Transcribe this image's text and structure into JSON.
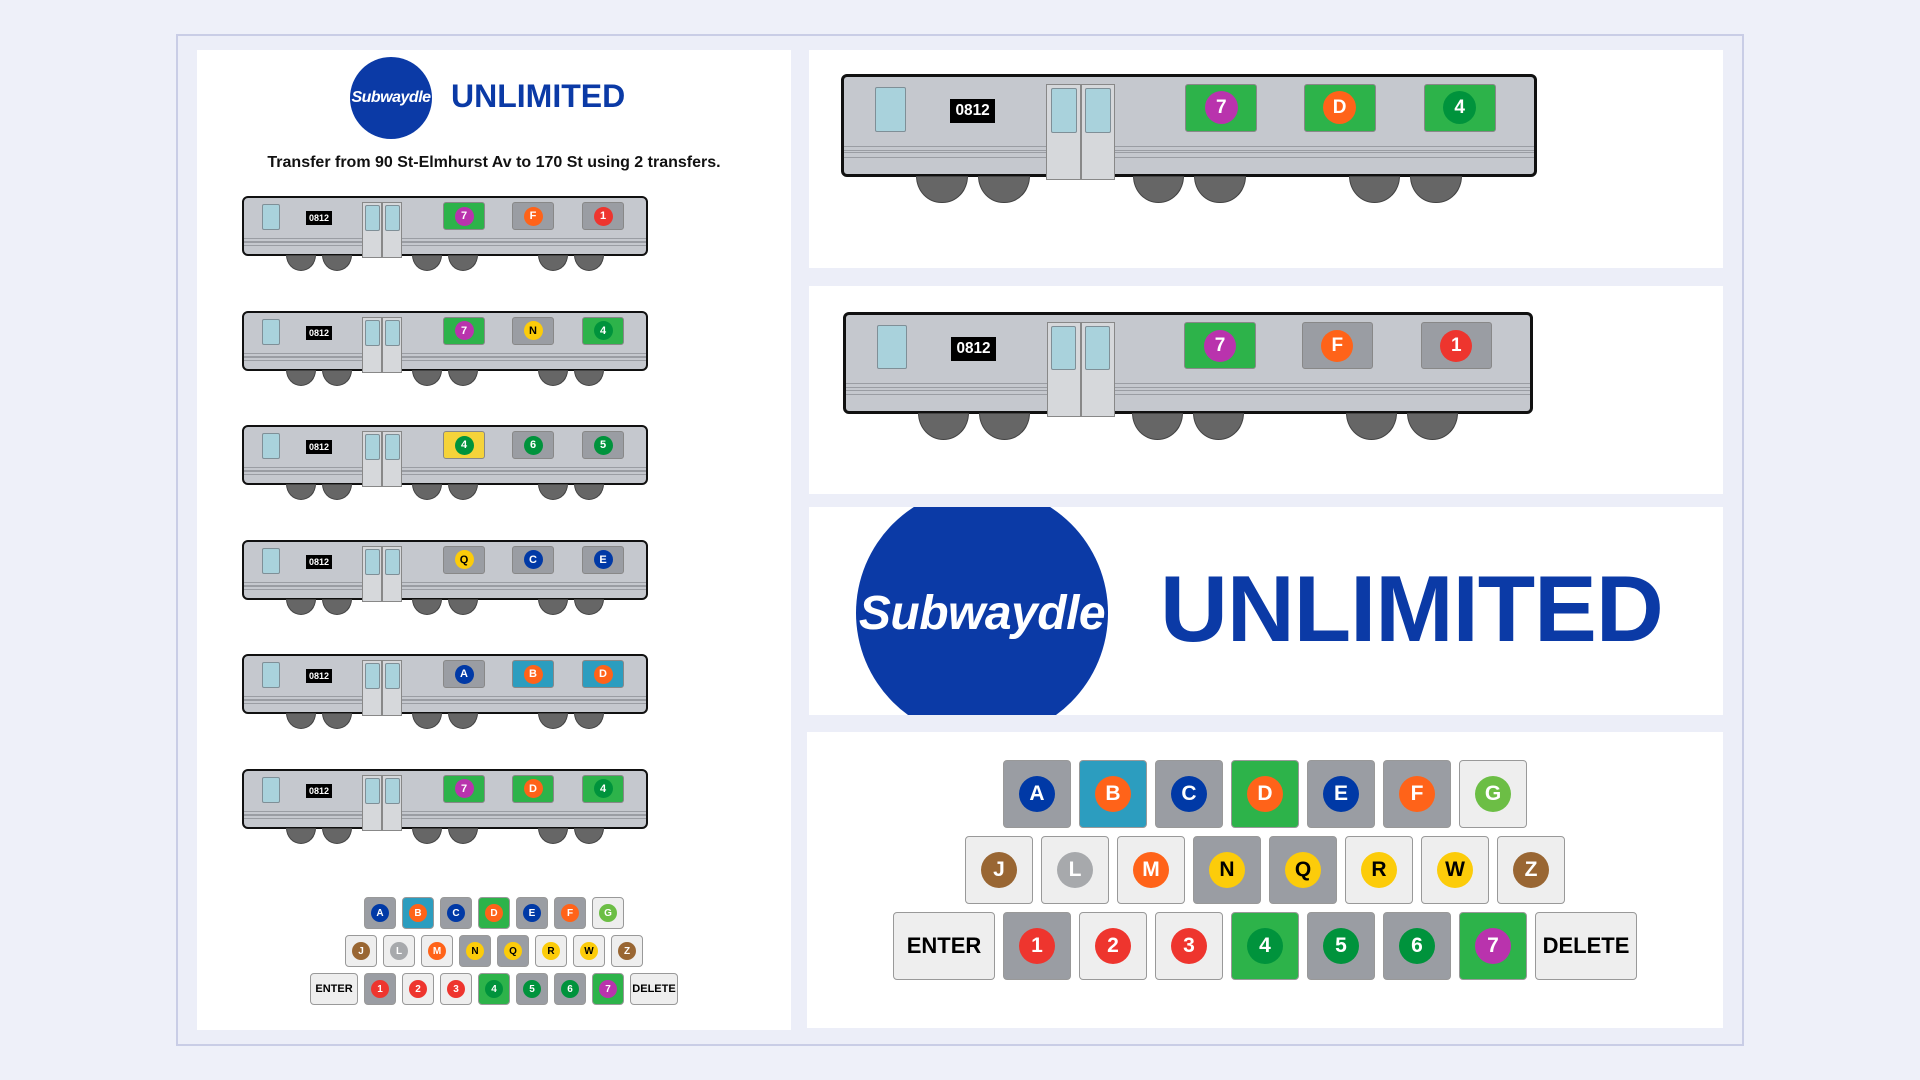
{
  "app": {
    "logo_text": "Subwaydle",
    "title": "UNLIMITED",
    "prompt": "Transfer from 90 St-Elmhurst Av to 170 St using 2 transfers.",
    "car_number": "0812"
  },
  "colors": {
    "brand_blue": "#0b3aa6",
    "green_correct": "#2db34a",
    "yellow_present": "#f5d33a",
    "teal_present": "#2c9dbf",
    "gray_absent": "#9a9da3",
    "car_body": "#c5c8ce"
  },
  "routes": {
    "A": {
      "color": "#0039a6",
      "text": "#fff"
    },
    "B": {
      "color": "#ff6319",
      "text": "#fff"
    },
    "C": {
      "color": "#0039a6",
      "text": "#fff"
    },
    "D": {
      "color": "#ff6319",
      "text": "#fff"
    },
    "E": {
      "color": "#0039a6",
      "text": "#fff"
    },
    "F": {
      "color": "#ff6319",
      "text": "#fff"
    },
    "G": {
      "color": "#6cbe45",
      "text": "#fff"
    },
    "J": {
      "color": "#996633",
      "text": "#fff"
    },
    "L": {
      "color": "#a7a9ac",
      "text": "#fff"
    },
    "M": {
      "color": "#ff6319",
      "text": "#fff"
    },
    "N": {
      "color": "#fccc0a",
      "text": "#000"
    },
    "Q": {
      "color": "#fccc0a",
      "text": "#000"
    },
    "R": {
      "color": "#fccc0a",
      "text": "#000"
    },
    "W": {
      "color": "#fccc0a",
      "text": "#000"
    },
    "Z": {
      "color": "#996633",
      "text": "#fff"
    },
    "1": {
      "color": "#ee352e",
      "text": "#fff"
    },
    "2": {
      "color": "#ee352e",
      "text": "#fff"
    },
    "3": {
      "color": "#ee352e",
      "text": "#fff"
    },
    "4": {
      "color": "#00933c",
      "text": "#fff"
    },
    "5": {
      "color": "#00933c",
      "text": "#fff"
    },
    "6": {
      "color": "#00933c",
      "text": "#fff"
    },
    "7": {
      "color": "#b933ad",
      "text": "#fff"
    }
  },
  "guesses": [
    [
      {
        "route": "7",
        "state": "correct"
      },
      {
        "route": "F",
        "state": "absent"
      },
      {
        "route": "1",
        "state": "absent"
      }
    ],
    [
      {
        "route": "7",
        "state": "correct"
      },
      {
        "route": "N",
        "state": "absent"
      },
      {
        "route": "4",
        "state": "correct"
      }
    ],
    [
      {
        "route": "4",
        "state": "present"
      },
      {
        "route": "6",
        "state": "absent"
      },
      {
        "route": "5",
        "state": "absent"
      }
    ],
    [
      {
        "route": "Q",
        "state": "absent"
      },
      {
        "route": "C",
        "state": "absent"
      },
      {
        "route": "E",
        "state": "absent"
      }
    ],
    [
      {
        "route": "A",
        "state": "absent"
      },
      {
        "route": "B",
        "state": "present-alt"
      },
      {
        "route": "D",
        "state": "present-alt"
      }
    ],
    [
      {
        "route": "7",
        "state": "correct"
      },
      {
        "route": "D",
        "state": "correct"
      },
      {
        "route": "4",
        "state": "correct"
      }
    ]
  ],
  "zoom_guesses": [
    [
      {
        "route": "7",
        "state": "correct"
      },
      {
        "route": "D",
        "state": "correct"
      },
      {
        "route": "4",
        "state": "correct"
      }
    ],
    [
      {
        "route": "7",
        "state": "correct"
      },
      {
        "route": "F",
        "state": "absent"
      },
      {
        "route": "1",
        "state": "absent"
      }
    ]
  ],
  "keyboard": {
    "rows": [
      [
        {
          "label": "A",
          "state": "absent"
        },
        {
          "label": "B",
          "state": "present-alt"
        },
        {
          "label": "C",
          "state": "absent"
        },
        {
          "label": "D",
          "state": "correct"
        },
        {
          "label": "E",
          "state": "absent"
        },
        {
          "label": "F",
          "state": "absent"
        },
        {
          "label": "G",
          "state": "none"
        }
      ],
      [
        {
          "label": "J",
          "state": "none"
        },
        {
          "label": "L",
          "state": "none"
        },
        {
          "label": "M",
          "state": "none"
        },
        {
          "label": "N",
          "state": "absent"
        },
        {
          "label": "Q",
          "state": "absent"
        },
        {
          "label": "R",
          "state": "none"
        },
        {
          "label": "W",
          "state": "none"
        },
        {
          "label": "Z",
          "state": "none"
        }
      ],
      [
        {
          "label": "ENTER",
          "state": "action"
        },
        {
          "label": "1",
          "state": "absent"
        },
        {
          "label": "2",
          "state": "none"
        },
        {
          "label": "3",
          "state": "none"
        },
        {
          "label": "4",
          "state": "correct"
        },
        {
          "label": "5",
          "state": "absent"
        },
        {
          "label": "6",
          "state": "absent"
        },
        {
          "label": "7",
          "state": "correct"
        },
        {
          "label": "DELETE",
          "state": "action"
        }
      ]
    ]
  }
}
